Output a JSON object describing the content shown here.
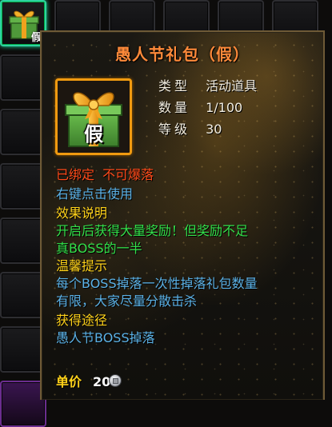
{
  "inventory": {
    "selected_slot_icon": "gift-box-icon",
    "selected_slot_label": "假"
  },
  "item": {
    "name": "愚人节礼包（假）",
    "icon": "gift-box-icon",
    "icon_label": "假",
    "properties": [
      {
        "key": "类型",
        "value": "活动道具"
      },
      {
        "key": "数量",
        "value": "1/100"
      },
      {
        "key": "等级",
        "value": "30"
      }
    ],
    "bind_status": "已绑定  不可爆落",
    "usage_hint": "右键点击使用",
    "effect_header": "效果说明",
    "effect_text": [
      "开启后获得大量奖励！但奖励不足",
      "真BOSS的一半"
    ],
    "tips_header": "温馨提示",
    "tips_text": [
      "每个BOSS掉落一次性掉落礼包数量",
      "有限，大家尽量分散击杀"
    ],
    "source_header": "获得途径",
    "source_text": "愚人节BOSS掉落",
    "price_label": "单价",
    "price_value": "20",
    "price_currency_icon": "silver-coin-icon"
  },
  "colors": {
    "title": "#ff8a3a",
    "bound": "#ff4a1a",
    "hint": "#5bb1e6",
    "header": "#ffd21a",
    "description": "#33e04a",
    "icon_border": "#f09a10",
    "selected_slot": "#2fd3a0"
  }
}
